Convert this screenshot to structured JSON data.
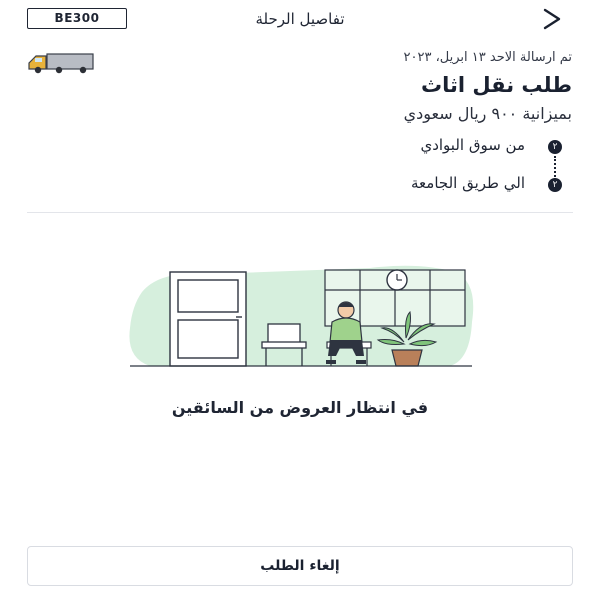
{
  "header": {
    "title": "تفاصيل الرحلة",
    "code": "BE300",
    "back_icon": "chevron-back-icon"
  },
  "request": {
    "sent_date": "تم ارسالة الاحد ١٣ ابريل، ٢٠٢٣",
    "title": "طلب نقل اثاث",
    "budget": "بميزانية ٩٠٠ ريال سعودي",
    "vehicle_icon": "truck-icon"
  },
  "route": {
    "from": {
      "marker": "٢",
      "label": "من سوق البوادي"
    },
    "to": {
      "marker": "٢",
      "label": "الي طريق الجامعة"
    }
  },
  "status": {
    "illustration": "waiting-room-illustration",
    "message": "في انتظار العروض من السائقين"
  },
  "actions": {
    "cancel_label": "إلغاء الطلب"
  },
  "colors": {
    "primary": "#1a2130",
    "illustration_green": "#d6efdd",
    "truck_yellow": "#e8b23a"
  }
}
